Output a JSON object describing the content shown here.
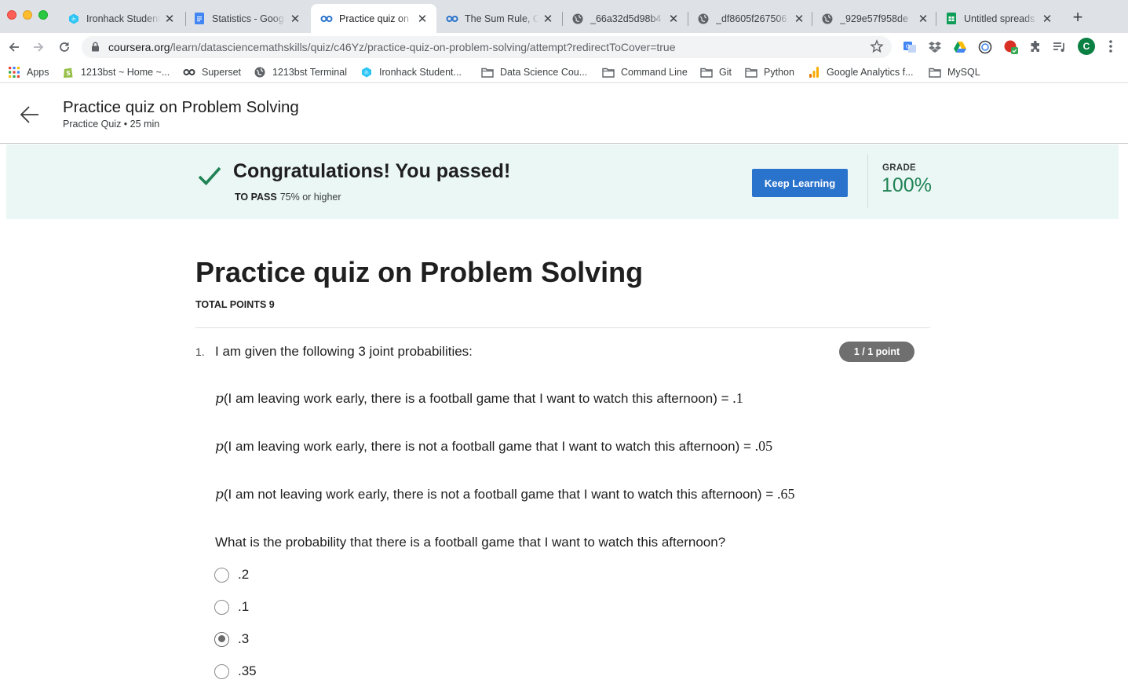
{
  "browser": {
    "tabs": [
      {
        "title": "Ironhack Student",
        "icon": "ironhack-icon",
        "active": false
      },
      {
        "title": "Statistics - Goog",
        "icon": "google-docs-icon",
        "active": false
      },
      {
        "title": "Practice quiz on",
        "icon": "coursera-icon",
        "active": true
      },
      {
        "title": "The Sum Rule, C",
        "icon": "coursera-icon",
        "active": false
      },
      {
        "title": "_66a32d5d98b4",
        "icon": "globe-icon",
        "active": false
      },
      {
        "title": "_df8605f267506",
        "icon": "globe-icon",
        "active": false
      },
      {
        "title": "_929e57f958de",
        "icon": "globe-icon",
        "active": false
      },
      {
        "title": "Untitled spreads",
        "icon": "google-sheets-icon",
        "active": false
      }
    ],
    "url_host": "coursera.org",
    "url_path": "/learn/datasciencemathskills/quiz/c46Yz/practice-quiz-on-problem-solving/attempt?redirectToCover=true",
    "profile_initial": "C",
    "bookmarks": [
      {
        "label": "Apps",
        "icon": "apps-grid-icon"
      },
      {
        "label": "1213bst ~ Home ~...",
        "icon": "shopify-icon"
      },
      {
        "label": "Superset",
        "icon": "superset-icon"
      },
      {
        "label": "1213bst Terminal",
        "icon": "globe-icon"
      },
      {
        "label": "Ironhack Student...",
        "icon": "ironhack-icon"
      },
      {
        "label": "Data Science Cou...",
        "icon": "folder-icon"
      },
      {
        "label": "Command Line",
        "icon": "folder-icon"
      },
      {
        "label": "Git",
        "icon": "folder-icon"
      },
      {
        "label": "Python",
        "icon": "folder-icon"
      },
      {
        "label": "Google Analytics f...",
        "icon": "analytics-icon"
      },
      {
        "label": "MySQL",
        "icon": "folder-icon"
      }
    ]
  },
  "header": {
    "title": "Practice quiz on Problem Solving",
    "subtitle": "Practice Quiz • 25 min"
  },
  "banner": {
    "message": "Congratulations! You passed!",
    "to_pass_label": "TO PASS",
    "to_pass_value": "75% or higher",
    "button_label": "Keep Learning",
    "grade_label": "GRADE",
    "grade_value": "100%"
  },
  "quiz": {
    "title": "Practice quiz on Problem Solving",
    "total_points": "TOTAL POINTS 9",
    "question": {
      "number": "1.",
      "text": "I am given the following 3 joint probabilities:",
      "points": "1 / 1 point",
      "probabilities": [
        {
          "p": "p",
          "text": "(I am leaving work early, there is a football game that I want to watch this afternoon) = ",
          "value": ".1"
        },
        {
          "p": "p",
          "text": "(I am leaving work early, there is not a football game that I want to watch this afternoon) = ",
          "value": ".05"
        },
        {
          "p": "p",
          "text": "(I am not leaving work early, there is not a football game that I want to watch this afternoon) = ",
          "value": ".65"
        }
      ],
      "prompt": "What is the probability that there is a football game that I want to watch this afternoon?",
      "options": [
        {
          "label": ".2",
          "selected": false
        },
        {
          "label": ".1",
          "selected": false
        },
        {
          "label": ".3",
          "selected": true
        },
        {
          "label": ".35",
          "selected": false
        }
      ]
    }
  },
  "colors": {
    "banner_bg": "#ebf7f5",
    "check_green": "#1f8354",
    "button_blue": "#2a73cc",
    "pill_gray": "#6f6f6f"
  }
}
